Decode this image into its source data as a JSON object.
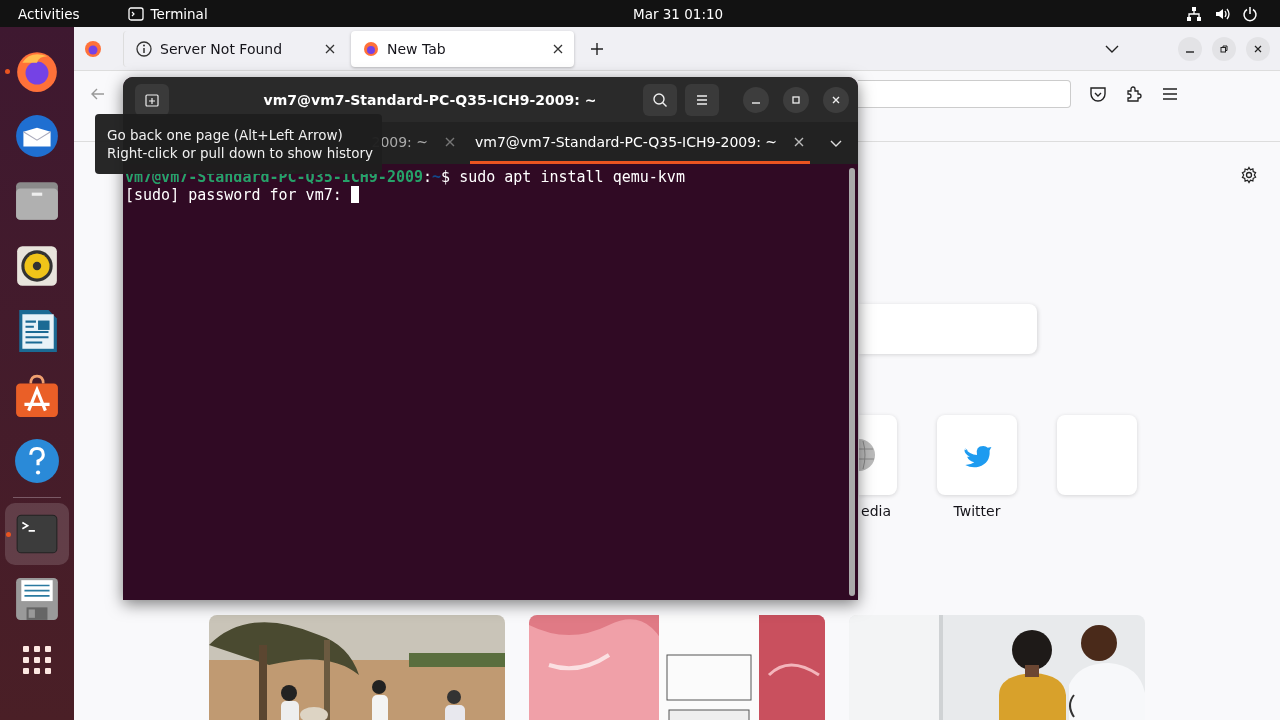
{
  "top_bar": {
    "activities": "Activities",
    "app_name": "Terminal",
    "clock": "Mar 31  01:10"
  },
  "dock": [
    {
      "kind": "firefox",
      "running": true,
      "selected": false
    },
    {
      "kind": "mail",
      "running": false,
      "selected": false
    },
    {
      "kind": "files",
      "running": false,
      "selected": false
    },
    {
      "kind": "speaker",
      "running": false,
      "selected": false
    },
    {
      "kind": "writer",
      "running": false,
      "selected": false
    },
    {
      "kind": "store",
      "running": false,
      "selected": false
    },
    {
      "kind": "help",
      "running": false,
      "selected": false
    },
    {
      "kind": "terminal",
      "running": true,
      "selected": true
    },
    {
      "kind": "floppy",
      "running": false,
      "selected": false
    }
  ],
  "browser": {
    "tabs": [
      {
        "kind": "info",
        "label": "Server Not Found",
        "selected": false
      },
      {
        "kind": "firefox",
        "label": "New Tab",
        "selected": true
      }
    ],
    "shortcuts": [
      {
        "kind": "globe",
        "label": "edia"
      },
      {
        "kind": "bird",
        "label": "Twitter"
      },
      {
        "kind": "blank"
      }
    ]
  },
  "terminal": {
    "title": "vm7@vm7-Standard-PC-Q35-ICH9-2009: ~",
    "tabs": [
      {
        "label": "2009: ~",
        "selected": false
      },
      {
        "label": "vm7@vm7-Standard-PC-Q35-ICH9-2009: ~",
        "selected": true
      }
    ],
    "lines": [
      {
        "kind": "prompt",
        "user_host": "vm7@vm7-Standard-PC-Q35-ICH9-2009",
        "colon": ":",
        "path": "~",
        "text": "$ sudo apt install qemu-kvm"
      },
      {
        "kind": "output",
        "text": "[sudo] password for vm7: ",
        "cursor": true
      }
    ]
  },
  "tooltip": {
    "lines": [
      "Go back one page (Alt+Left Arrow)",
      "Right-click or pull down to show history"
    ]
  }
}
